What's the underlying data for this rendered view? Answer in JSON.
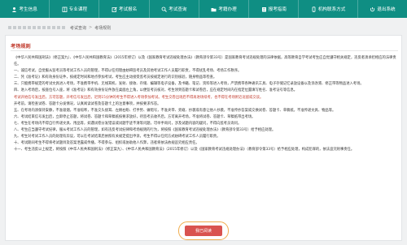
{
  "nav": [
    {
      "label": "考生信息",
      "icon": "user-icon"
    },
    {
      "label": "专业课程",
      "icon": "book-icon"
    },
    {
      "label": "考试报名",
      "icon": "edit-icon"
    },
    {
      "label": "考试查询",
      "icon": "search-icon"
    },
    {
      "label": "考籍办理",
      "icon": "folder-icon"
    },
    {
      "label": "报考指南",
      "icon": "guide-icon"
    },
    {
      "label": "机构联系方式",
      "icon": "phone-icon"
    },
    {
      "label": "退出系统",
      "icon": "exit-icon"
    }
  ],
  "breadcrumb": [
    "考试查询",
    "考场规则"
  ],
  "section_title": "考场规则",
  "paragraphs": [
    "《中华人民共和国刑法》（修正案九）、《中华人民共和国教育法》（2015年修订）以及《国家教育考试违规处理办法》（教育部令第33号）是国家教育考试违规处理的法律依据，高等教育自学考试考生应自觉遵守相关规定，违反者须承担相应的法律责任。",
    "一、诚信考试，自觉服从监考员等考试工作人员的管理，不得以任何理由妨碍监考员及其他考试工作人员履行职责，不得扰乱考场、考场工作秩序。",
    "二、凭《准考证》和有效身份证件，按规定时间和地点参加考试，考生应主动接受监考员按规定进行的识别核验，随身物品等检查。",
    "三、只能携带规定的考试文具进入考场，不准携带手机、无线耳机、发射、接收、存储、编辑等电子设备，及书籍、笔记、资料等进入考场，严禁携带各种通讯工具、电子存储记忆录放设备以及涂改液、修正带等物品进入考场。",
    "四、进入考场后，按座位号入座，将《准考证》和有效身份证件放在桌面左上角，以便监考员核对，考生领到答题卡和试卷后，应在规定时间内在指定位置填写姓名、准考证号等信息。",
    "考试开始信号发出后，方可答题，开考信号发出后，迟到15分钟的考生不得进入考场参加考试。考生交卷出场后不得再进场续考，也不得在考场附近逗留或交谈。",
    "开考前，请检查试卷、答题卡分发情况，认真阅读试卷及答题卡上的注意事项，并按要求作答。",
    "五、在考场内须保持安静，不准吸烟，不准喧哗，不准交头接耳、左顾右盼、打手势、做暗号，不准夹带、旁窥、抄袭或有意让他人抄袭，不准传抄答案或交换试卷、答题卡、草稿纸，不准传递文具、物品等。",
    "六、考试结束信号发出后，立即停止答题，将试卷、答题卡和草稿纸按要求放好，待监考员收齐后，方可离开考场，不准将试卷、答题卡、草稿纸带出考场。",
    "七、考生在考场内不得自行传递文具、用品等，如遇试卷分发错误或试题字迹不清等问题，可举手询问，涉及试题内容的疑问，不得向监考员询问。",
    "八、考生应当遵守考试纪律，服从考试工作人员的管理，如有违反考试纪律和考场规则的行为，将按照《国家教育考试违规处理办法》（教育部令第33号）给予相应处理。",
    "九、考生对考试工作人员的处理有异议，可以在考试结束后依照有关规定提出申诉，考生不得以任何方式妨碍考试工作人员履行职责。",
    "十、考试期间考生不得将考试题目及答案泄露或传播，不得参与、组织或协助他人作弊，违者将依法依规追究相应责任。",
    "十一、考生违反以上规定，将按照《中华人民共和国刑法》（修正案九）、《中华人民共和国教育法》（2015年修订）以及《国家教育考试违规处理办法》（教育部令第33号）给予相应处理，构成犯罪的，依法追究刑事责任。"
  ],
  "confirm_button": "我已阅读"
}
